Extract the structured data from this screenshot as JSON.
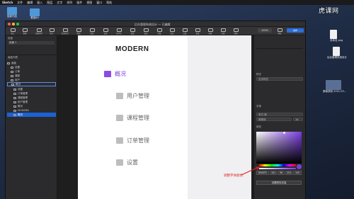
{
  "menubar": {
    "app": "Sketch",
    "items": [
      "文件",
      "编辑",
      "插入",
      "图层",
      "文字",
      "排列",
      "插件",
      "视图",
      "窗口",
      "帮助"
    ]
  },
  "watermark": "虎课网",
  "desktop": {
    "items": [
      {
        "label": "独家作品"
      },
      {
        "label": "素描60"
      },
      {
        "label": "未命名.png"
      },
      {
        "label": "后台管理系统设计"
      },
      {
        "label": "屏幕录制 2021-03..."
      }
    ]
  },
  "window": {
    "title": "后台管理系统设计 — 已编辑"
  },
  "toolbar": {
    "items": [
      "插入",
      "数据",
      "创建组件",
      "组合",
      "取消组合",
      "编辑",
      "旋转",
      "变换",
      "扁平化",
      "蒙版",
      "缩放",
      "并集",
      "减去",
      "交集",
      "差集",
      "前移",
      "后移",
      "镜像",
      "预览",
      "协作",
      "显示"
    ],
    "zoom": "100%"
  },
  "layers": {
    "page_header": "页面",
    "page": "页面 1",
    "artboard_header": "画板列表",
    "items": [
      {
        "label": "画板",
        "indent": 0
      },
      {
        "label": "设置",
        "indent": 1
      },
      {
        "label": "订单",
        "indent": 1
      },
      {
        "label": "课程",
        "indent": 1
      },
      {
        "label": "用户",
        "indent": 1
      },
      {
        "label": "概况",
        "indent": 1
      },
      {
        "label": "设置",
        "indent": 2
      },
      {
        "label": "订单管理",
        "indent": 2
      },
      {
        "label": "课程管理",
        "indent": 2
      },
      {
        "label": "用户管理",
        "indent": 2
      },
      {
        "label": "概况",
        "indent": 2
      },
      {
        "label": "MODERN",
        "indent": 2
      },
      {
        "label": "概况",
        "indent": 2
      }
    ]
  },
  "artboard": {
    "logo": "MODERN",
    "nav": [
      {
        "label": "概况",
        "icon": "dashboard-icon",
        "active": true
      },
      {
        "label": "用户管理",
        "icon": "user-icon",
        "active": false
      },
      {
        "label": "课程管理",
        "icon": "course-icon",
        "active": false
      },
      {
        "label": "订单管理",
        "icon": "order-icon",
        "active": false
      },
      {
        "label": "设置",
        "icon": "settings-icon",
        "active": false
      }
    ],
    "accent": "#7A3DE0"
  },
  "inspector": {
    "style_label": "样式",
    "text_style": "文字样式",
    "font_section": "字体",
    "font_family": "苹方-简",
    "font_weight": "常规体",
    "font_size": "16",
    "fill_label": "填充",
    "hex": "8060FE",
    "values": [
      "161",
      "96",
      "254",
      "100"
    ],
    "save_label": "设置颜色变量"
  },
  "annotation": "调整字体颜色"
}
